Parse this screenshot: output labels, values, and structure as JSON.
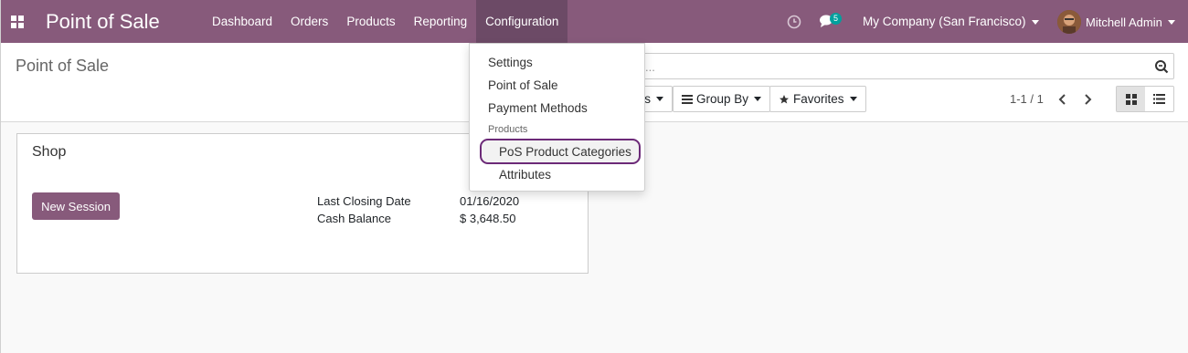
{
  "navbar": {
    "brand": "Point of Sale",
    "menu": [
      {
        "label": "Dashboard"
      },
      {
        "label": "Orders"
      },
      {
        "label": "Products"
      },
      {
        "label": "Reporting"
      },
      {
        "label": "Configuration"
      }
    ],
    "chat_count": "5",
    "company": "My Company (San Francisco)",
    "user": "Mitchell Admin",
    "accent_color": "#875a7b"
  },
  "control_panel": {
    "breadcrumb": "Point of Sale",
    "search_placeholder": "...",
    "filters_label": "s",
    "group_by_label": "Group By",
    "favorites_label": "Favorites",
    "pager": "1-1 / 1"
  },
  "card": {
    "title": "Shop",
    "button_label": "New Session",
    "rows": [
      {
        "label": "Last Closing Date",
        "value": "01/16/2020"
      },
      {
        "label": "Cash Balance",
        "value": "$ 3,648.50"
      }
    ]
  },
  "dropdown": {
    "items": [
      "Settings",
      "Point of Sale",
      "Payment Methods"
    ],
    "section_header": "Products",
    "sub_items": [
      "PoS Product Categories",
      "Attributes"
    ],
    "highlight_color": "#6c2a78"
  }
}
